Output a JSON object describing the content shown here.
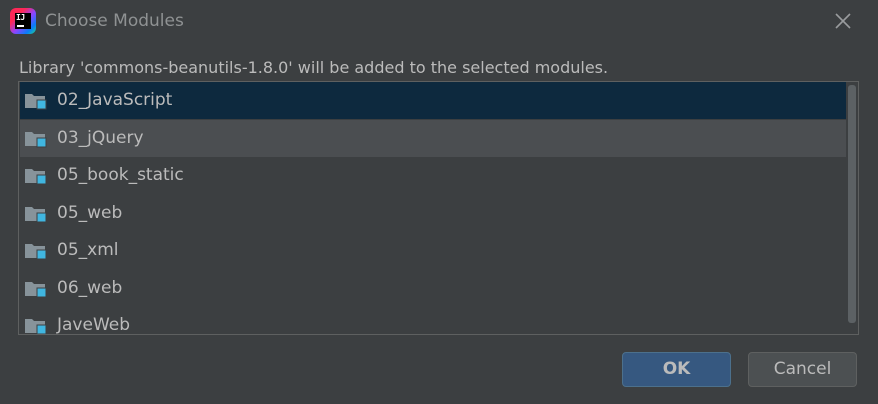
{
  "window": {
    "title": "Choose Modules",
    "app_icon_text": "IJ",
    "close_icon": "close-icon"
  },
  "message": "Library 'commons-beanutils-1.8.0' will be added to the selected modules.",
  "modules": {
    "items": [
      {
        "label": "02_JavaScript",
        "state": "selected",
        "icon": "module-folder-icon"
      },
      {
        "label": "03_jQuery",
        "state": "hover",
        "icon": "module-folder-icon"
      },
      {
        "label": "05_book_static",
        "state": "normal",
        "icon": "module-folder-icon"
      },
      {
        "label": "05_web",
        "state": "normal",
        "icon": "module-folder-icon"
      },
      {
        "label": "05_xml",
        "state": "normal",
        "icon": "module-folder-icon"
      },
      {
        "label": "06_web",
        "state": "normal",
        "icon": "module-folder-icon"
      },
      {
        "label": "JaveWeb",
        "state": "normal",
        "icon": "module-folder-icon"
      }
    ]
  },
  "buttons": {
    "ok_label": "OK",
    "cancel_label": "Cancel"
  },
  "colors": {
    "background": "#3c3f41",
    "selected_row": "#0d293e",
    "hover_row": "#4b4e51",
    "primary_button": "#365880",
    "folder": "#87939a",
    "module_badge": "#40b6e0",
    "text": "#bbbbbb"
  }
}
